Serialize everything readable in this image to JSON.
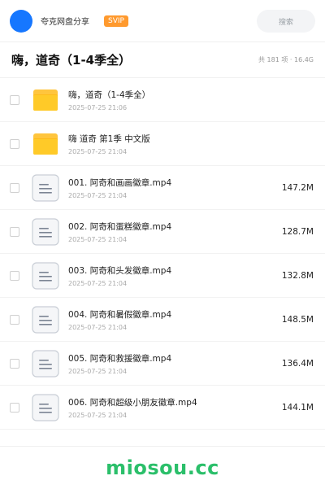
{
  "header": {
    "app_name": "夸克网盘分享",
    "badge": "SVIP",
    "search_placeholder": "搜索"
  },
  "folder": {
    "title": "嗨，道奇（1-4季全）",
    "summary": "共 181 项 · 16.4G"
  },
  "items": [
    {
      "type": "folder",
      "name": "嗨，道奇（1-4季全）",
      "date": "2025-07-25 21:06",
      "size": ""
    },
    {
      "type": "folder",
      "name": "嗨 道奇 第1季 中文版",
      "date": "2025-07-25 21:04",
      "size": ""
    },
    {
      "type": "file",
      "name": "001. 阿奇和画画徽章.mp4",
      "date": "2025-07-25 21:04",
      "size": "147.2M"
    },
    {
      "type": "file",
      "name": "002. 阿奇和蛋糕徽章.mp4",
      "date": "2025-07-25 21:04",
      "size": "128.7M"
    },
    {
      "type": "file",
      "name": "003. 阿奇和头发徽章.mp4",
      "date": "2025-07-25 21:04",
      "size": "132.8M"
    },
    {
      "type": "file",
      "name": "004. 阿奇和暑假徽章.mp4",
      "date": "2025-07-25 21:04",
      "size": "148.5M"
    },
    {
      "type": "file",
      "name": "005. 阿奇和救援徽章.mp4",
      "date": "2025-07-25 21:04",
      "size": "136.4M"
    },
    {
      "type": "file",
      "name": "006. 阿奇和超级小朋友徽章.mp4",
      "date": "2025-07-25 21:04",
      "size": "144.1M"
    }
  ],
  "footer": {
    "watermark": "miosou.cc"
  },
  "colors": {
    "accent": "#1677ff",
    "svip": "#ff9a2e",
    "folder": "#ffc53d",
    "watermark": "#2bbf6a"
  },
  "icons": {
    "folder": "folder-icon",
    "file": "video-file-icon"
  }
}
